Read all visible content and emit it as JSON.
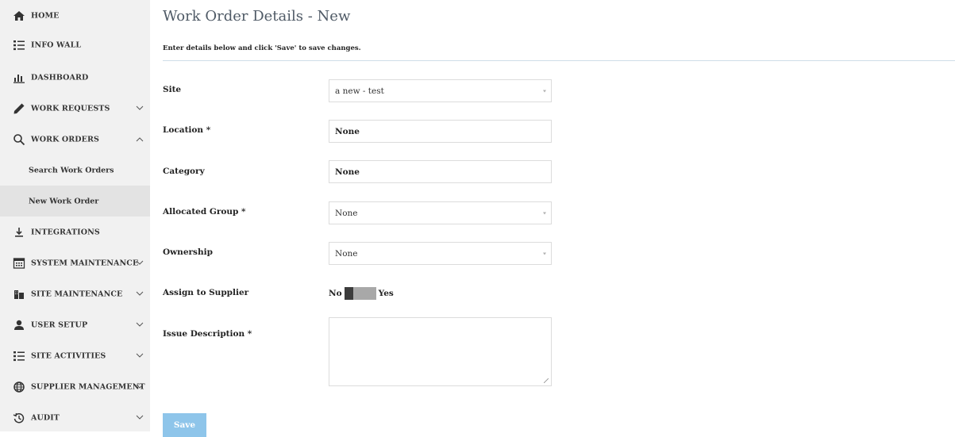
{
  "sidebar": {
    "items": [
      {
        "label": "HOME",
        "icon": "home-icon"
      },
      {
        "label": "INFO WALL",
        "icon": "list-icon"
      },
      {
        "label": "DASHBOARD",
        "icon": "bar-chart-icon"
      },
      {
        "label": "WORK REQUESTS",
        "icon": "pencil-icon",
        "chevron": "down"
      },
      {
        "label": "WORK ORDERS",
        "icon": "search-icon",
        "chevron": "up"
      },
      {
        "label": "INTEGRATIONS",
        "icon": "arrow-down-icon"
      },
      {
        "label": "SYSTEM MAINTENANCE",
        "icon": "calendar-icon",
        "chevron": "down"
      },
      {
        "label": "SITE MAINTENANCE",
        "icon": "building-icon",
        "chevron": "down"
      },
      {
        "label": "USER SETUP",
        "icon": "user-icon",
        "chevron": "down"
      },
      {
        "label": "SITE ACTIVITIES",
        "icon": "list-icon",
        "chevron": "down"
      },
      {
        "label": "SUPPLIER MANAGEMENT",
        "icon": "globe-icon",
        "chevron": "down"
      },
      {
        "label": "AUDIT",
        "icon": "history-icon",
        "chevron": "down"
      }
    ],
    "subitems": [
      {
        "label": "Search Work Orders"
      },
      {
        "label": "New Work Order",
        "active": true
      }
    ]
  },
  "main": {
    "title": "Work Order Details - New",
    "instructions": "Enter details below and click 'Save' to save changes.",
    "form": {
      "site": {
        "label": "Site",
        "value": "a new - test"
      },
      "location": {
        "label": "Location *",
        "value": "None"
      },
      "category": {
        "label": "Category",
        "value": "None"
      },
      "allocated_group": {
        "label": "Allocated Group *",
        "value": "None"
      },
      "ownership": {
        "label": "Ownership",
        "value": "None"
      },
      "assign_to_supplier": {
        "label": "Assign to Supplier",
        "off_label": "No",
        "on_label": "Yes",
        "state": "No"
      },
      "issue_description": {
        "label": "Issue Description *",
        "value": ""
      }
    },
    "save_label": "Save"
  },
  "colors": {
    "sidebar_bg": "#f1f1f1",
    "active_sub_bg": "#e3e3e3",
    "title": "#4f5a66",
    "rule": "#cfdde8",
    "save_button": "#8ec5ea"
  }
}
